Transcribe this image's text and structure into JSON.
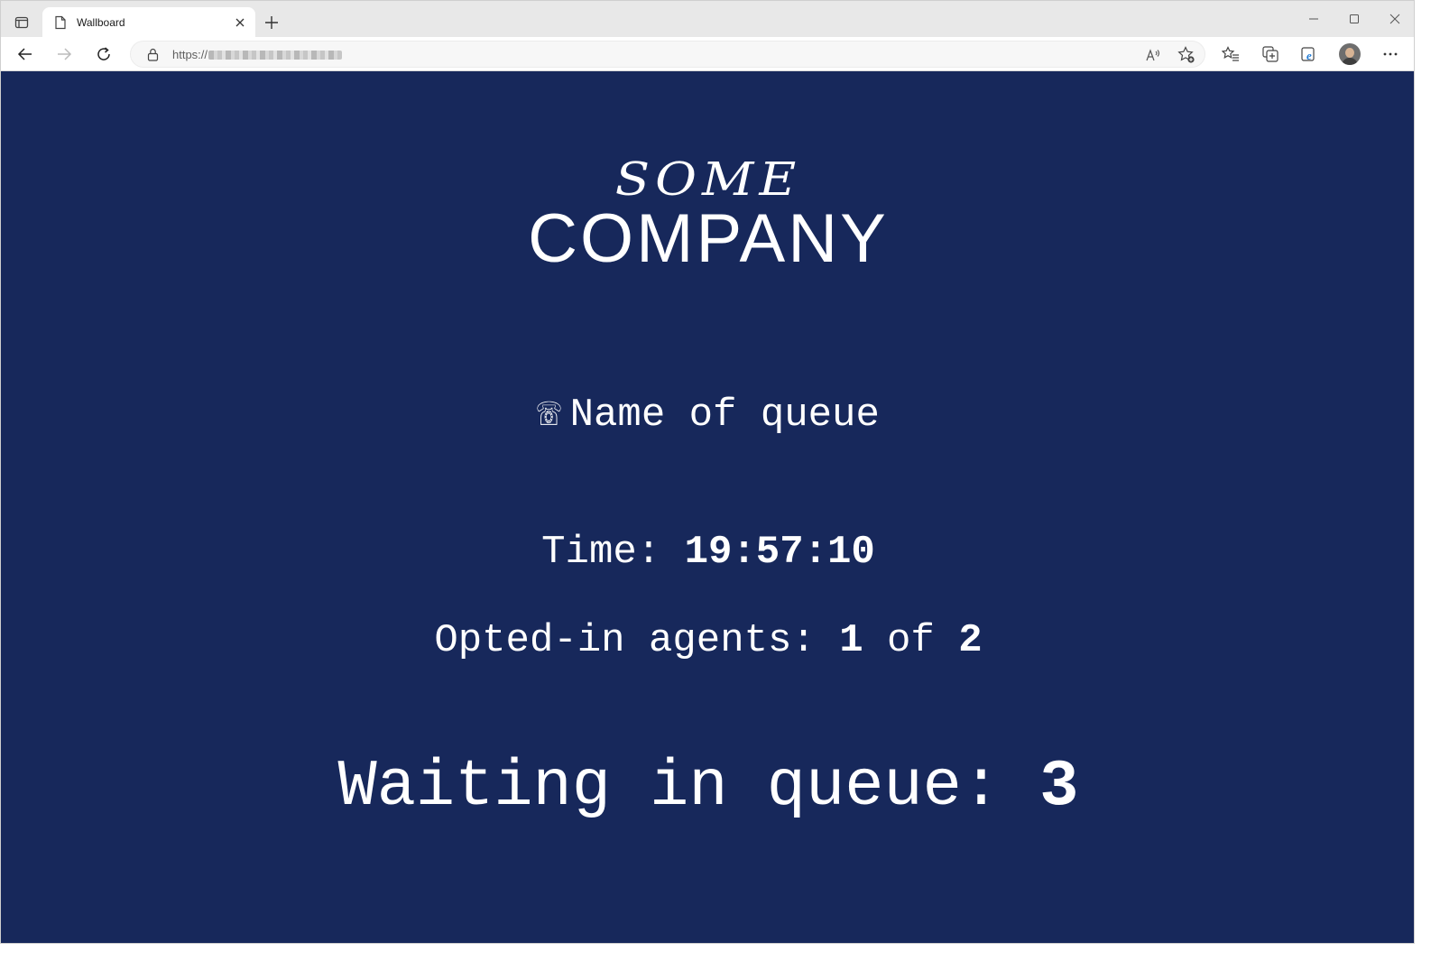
{
  "browser": {
    "tab_title": "Wallboard",
    "url_prefix": "https://"
  },
  "icons": {
    "tab_actions": "tab-actions-icon",
    "favicon": "page-icon",
    "close": "close-icon",
    "new_tab": "plus-icon",
    "back": "back-arrow-icon",
    "forward": "forward-arrow-icon",
    "refresh": "refresh-icon",
    "lock": "lock-icon",
    "read_aloud": "read-aloud-icon",
    "add_favorite": "add-favorite-icon",
    "favorites": "favorites-icon",
    "collections": "collections-icon",
    "ie_mode": "ie-mode-icon",
    "more": "more-icon",
    "phone": "phone-icon"
  },
  "colors": {
    "page_background": "#17285b",
    "text": "#ffffff"
  },
  "wallboard": {
    "logo_line1": "SOME",
    "logo_line2": "COMPANY",
    "phone_glyph": "☏",
    "queue_name": "Name of queue",
    "time_label": "Time:",
    "time_value": "19:57:10",
    "agents_label": "Opted-in agents:",
    "agents_opted_in": "1",
    "agents_of": "of",
    "agents_total": "2",
    "waiting_label": "Waiting in queue:",
    "waiting_value": "3"
  }
}
